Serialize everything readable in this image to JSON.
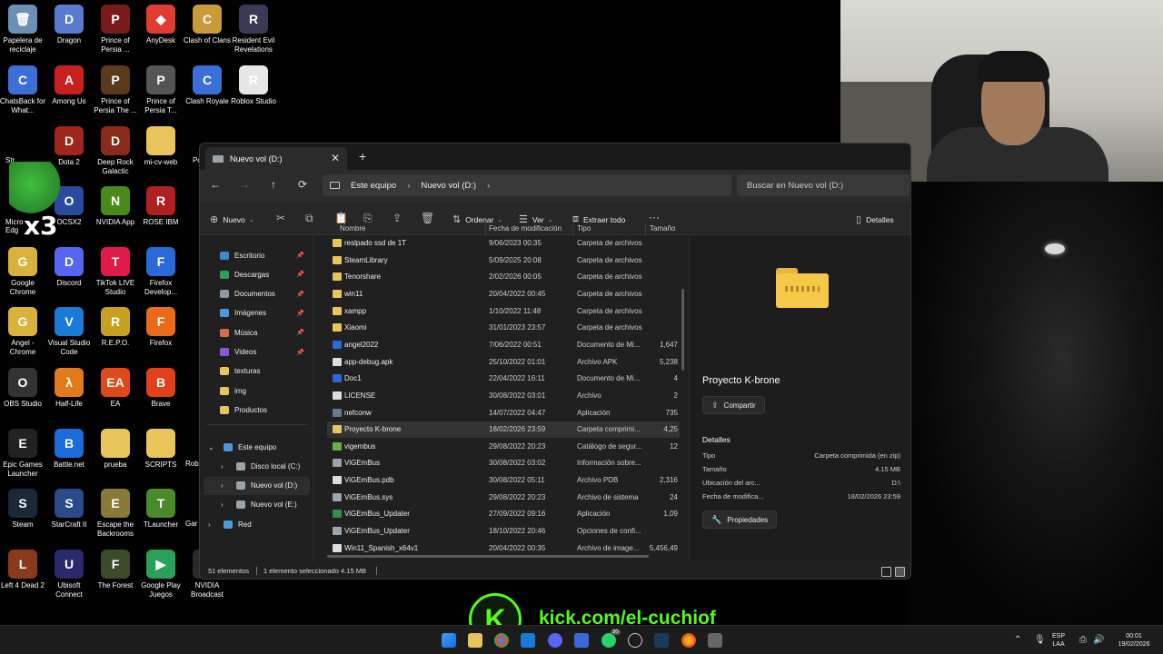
{
  "desktop": {
    "icons": [
      {
        "label": "Papelera de reciclaje",
        "color": "#6b8fb5",
        "glyph": "🗑"
      },
      {
        "label": "Dragon",
        "color": "#5a7ad0",
        "glyph": "D"
      },
      {
        "label": "Prince of Persia ...",
        "color": "#7a1b1b",
        "glyph": "P"
      },
      {
        "label": "AnyDesk",
        "color": "#e03c31",
        "glyph": "◆"
      },
      {
        "label": "Clash of Clans",
        "color": "#c89a3a",
        "glyph": "C"
      },
      {
        "label": "Resident Evil Revelations",
        "color": "#3a3a55",
        "glyph": "R"
      },
      {
        "label": "ChatsBack for What...",
        "color": "#3d6fd8",
        "glyph": "C"
      },
      {
        "label": "Among Us",
        "color": "#c82020",
        "glyph": "A"
      },
      {
        "label": "Prince of Persia The ...",
        "color": "#5a3a1a",
        "glyph": "P"
      },
      {
        "label": "Prince of Persia T...",
        "color": "#555555",
        "glyph": "P"
      },
      {
        "label": "Clash Royale",
        "color": "#3a6fd8",
        "glyph": "C"
      },
      {
        "label": "Roblox Studio",
        "color": "#e6e6e6",
        "glyph": "R"
      },
      {
        "label": "Dota 2",
        "color": "#a0251d",
        "glyph": "D"
      },
      {
        "label": "Deep Rock Galactic",
        "color": "#8a2a1a",
        "glyph": "D"
      },
      {
        "label": "mi-cv-web",
        "color": "#e8c45a",
        "glyph": ""
      },
      {
        "label": "OCSX2",
        "color": "#2a4aa0",
        "glyph": "O"
      },
      {
        "label": "NVIDIA App",
        "color": "#4a8a1a",
        "glyph": "N"
      },
      {
        "label": "ROSE IBM",
        "color": "#b02020",
        "glyph": "R"
      },
      {
        "label": "Google Chrome",
        "color": "#d8b23a",
        "glyph": "G"
      },
      {
        "label": "Discord",
        "color": "#5865f2",
        "glyph": "D"
      },
      {
        "label": "TikTok LIVE Studio",
        "color": "#e01a4a",
        "glyph": "T"
      },
      {
        "label": "Firefox Develop...",
        "color": "#2a6ad8",
        "glyph": "F"
      },
      {
        "label": "Angel - Chrome",
        "color": "#d8b23a",
        "glyph": "G"
      },
      {
        "label": "Visual Studio Code",
        "color": "#1a7ad8",
        "glyph": "V"
      },
      {
        "label": "R.E.P.O.",
        "color": "#c8a020",
        "glyph": "R"
      },
      {
        "label": "Firefox",
        "color": "#e86a1a",
        "glyph": "F"
      },
      {
        "label": "OBS Studio",
        "color": "#333333",
        "glyph": "O"
      },
      {
        "label": "Half-Life",
        "color": "#e07a1a",
        "glyph": "λ"
      },
      {
        "label": "EA",
        "color": "#e04a1a",
        "glyph": "EA"
      },
      {
        "label": "Brave",
        "color": "#e0401a",
        "glyph": "B"
      },
      {
        "label": "Epic Games Launcher",
        "color": "#222222",
        "glyph": "E"
      },
      {
        "label": "Battle.net",
        "color": "#1a6ad8",
        "glyph": "B"
      },
      {
        "label": "prueba",
        "color": "#e8c45a",
        "glyph": ""
      },
      {
        "label": "SCRIPTS",
        "color": "#e8c45a",
        "glyph": ""
      },
      {
        "label": "Steam",
        "color": "#1b2838",
        "glyph": "S"
      },
      {
        "label": "StarCraft II",
        "color": "#2a4a8a",
        "glyph": "S"
      },
      {
        "label": "Escape the Backrooms",
        "color": "#8a7a3a",
        "glyph": "E"
      },
      {
        "label": "TLauncher",
        "color": "#4a8a2a",
        "glyph": "T"
      },
      {
        "label": "Left 4 Dead 2",
        "color": "#8a3a1a",
        "glyph": "L"
      },
      {
        "label": "Ubisoft Connect",
        "color": "#2a2a6a",
        "glyph": "U"
      },
      {
        "label": "The Forest",
        "color": "#3a4a2a",
        "glyph": "F"
      },
      {
        "label": "Google Play Juegos",
        "color": "#2aa05a",
        "glyph": "▶"
      },
      {
        "label": "NVIDIA Broadcast",
        "color": "#2a2a2a",
        "glyph": "N"
      }
    ],
    "partial_labels": [
      "Po",
      "Str",
      "Micro Edg",
      "Rob",
      "Gar"
    ],
    "overlay_text": "x3"
  },
  "explorer": {
    "tab_title": "Nuevo vol (D:)",
    "tab_close": "✕",
    "new_tab": "+",
    "nav": {
      "back": "←",
      "forward": "→",
      "up": "↑",
      "refresh": "⟳"
    },
    "breadcrumb": [
      "Este equipo",
      "Nuevo vol (D:)"
    ],
    "breadcrumb_sep": "›",
    "search_placeholder": "Buscar en Nuevo vol (D:)",
    "commands": {
      "new": "Nuevo",
      "sort": "Ordenar",
      "view": "Ver",
      "extract": "Extraer todo",
      "more": "···",
      "details": "Detalles"
    },
    "sidebar": {
      "quick": [
        {
          "label": "Escritorio",
          "color": "#3a8ad8",
          "pinned": true
        },
        {
          "label": "Descargas",
          "color": "#2aa05a",
          "pinned": true
        },
        {
          "label": "Documentos",
          "color": "#8a9aaa",
          "pinned": true
        },
        {
          "label": "Imágenes",
          "color": "#4a9ae0",
          "pinned": true
        },
        {
          "label": "Música",
          "color": "#d86a4a",
          "pinned": true
        },
        {
          "label": "Videos",
          "color": "#8a5ad8",
          "pinned": true
        },
        {
          "label": "texturas",
          "color": "#e8c45a",
          "pinned": false
        },
        {
          "label": "img",
          "color": "#e8c45a",
          "pinned": false
        },
        {
          "label": "Productos",
          "color": "#e8c45a",
          "pinned": false
        }
      ],
      "tree": [
        {
          "label": "Este equipo",
          "color": "#4a9ae0",
          "expanded": true
        },
        {
          "label": "Disco local (C:)",
          "color": "#9aa4ad",
          "expanded": false
        },
        {
          "label": "Nuevo vol (D:)",
          "color": "#9aa4ad",
          "expanded": false,
          "selected": true
        },
        {
          "label": "Nuevo vol (E:)",
          "color": "#9aa4ad",
          "expanded": false
        },
        {
          "label": "Red",
          "color": "#4a9ae0",
          "expanded": false
        }
      ]
    },
    "columns": {
      "name": "Nombre",
      "date": "Fecha de modificación",
      "type": "Tipo",
      "size": "Tamaño"
    },
    "files": [
      {
        "name": "reslpado ssd de 1T",
        "date": "9/06/2023 00:35",
        "type": "Carpeta de archivos",
        "size": "",
        "color": "#e8c45a"
      },
      {
        "name": "SteamLibrary",
        "date": "5/09/2025 20:08",
        "type": "Carpeta de archivos",
        "size": "",
        "color": "#e8c45a"
      },
      {
        "name": "Tenorshare",
        "date": "2/02/2026 00:05",
        "type": "Carpeta de archivos",
        "size": "",
        "color": "#e8c45a"
      },
      {
        "name": "win11",
        "date": "20/04/2022 00:45",
        "type": "Carpeta de archivos",
        "size": "",
        "color": "#e8c45a"
      },
      {
        "name": "xampp",
        "date": "1/10/2022 11:48",
        "type": "Carpeta de archivos",
        "size": "",
        "color": "#e8c45a"
      },
      {
        "name": "Xiaomi",
        "date": "31/01/2023 23:57",
        "type": "Carpeta de archivos",
        "size": "",
        "color": "#e8c45a"
      },
      {
        "name": "angel2022",
        "date": "7/06/2022 00:51",
        "type": "Documento de Mi...",
        "size": "1,647",
        "color": "#2a6ad8"
      },
      {
        "name": "app-debug.apk",
        "date": "25/10/2022 01:01",
        "type": "Archivo APK",
        "size": "5,238",
        "color": "#dddddd"
      },
      {
        "name": "Doc1",
        "date": "22/04/2022 16:11",
        "type": "Documento de Mi...",
        "size": "4",
        "color": "#2a6ad8"
      },
      {
        "name": "LICENSE",
        "date": "30/08/2022 03:01",
        "type": "Archivo",
        "size": "2",
        "color": "#dddddd"
      },
      {
        "name": "nefconw",
        "date": "14/07/2022 04:47",
        "type": "Aplicación",
        "size": "735",
        "color": "#6a7a8a"
      },
      {
        "name": "Proyecto K-brone",
        "date": "18/02/2026 23:59",
        "type": "Carpeta comprimi...",
        "size": "4,25",
        "color": "#e8c45a",
        "selected": true
      },
      {
        "name": "vigembus",
        "date": "29/08/2022 20:23",
        "type": "Catálogo de segur...",
        "size": "12",
        "color": "#6ab04a"
      },
      {
        "name": "ViGEmBus",
        "date": "30/08/2022 03:02",
        "type": "Información sobre...",
        "size": "",
        "color": "#9aa4ad"
      },
      {
        "name": "ViGEmBus.pdb",
        "date": "30/08/2022 05:11",
        "type": "Archivo PDB",
        "size": "2,316",
        "color": "#dddddd"
      },
      {
        "name": "ViGEmBus.sys",
        "date": "29/08/2022 20:23",
        "type": "Archivo de sistema",
        "size": "24",
        "color": "#9aa4ad"
      },
      {
        "name": "ViGEmBus_Updater",
        "date": "27/09/2022 09:16",
        "type": "Aplicación",
        "size": "1,09",
        "color": "#3a8a4a"
      },
      {
        "name": "ViGEmBus_Updater",
        "date": "18/10/2022 20:46",
        "type": "Opciones de confi...",
        "size": "",
        "color": "#9aa4ad"
      },
      {
        "name": "Win11_Spanish_x64v1",
        "date": "20/04/2022 00:35",
        "type": "Archivo de image...",
        "size": "5,456,49",
        "color": "#dddddd"
      }
    ],
    "details_pane": {
      "title": "Proyecto K-brone",
      "share": "Compartir",
      "section": "Detalles",
      "props": [
        {
          "k": "Tipo",
          "v": "Carpeta comprimida (en zip)"
        },
        {
          "k": "Tamaño",
          "v": "4.15 MB"
        },
        {
          "k": "Ubicación del arc...",
          "v": "D:\\"
        },
        {
          "k": "Fecha de modifica...",
          "v": "18/02/2026 23:59"
        }
      ],
      "properties_button": "Propiedades"
    },
    "status": {
      "count": "51 elementos",
      "selection": "1 elemento seleccionado  4.15 MB"
    }
  },
  "overlay": {
    "kick_letter": "K",
    "kick_url": "kick.com/el-cuchiof"
  },
  "taskbar": {
    "badge": "30",
    "tray": {
      "lang1": "ESP",
      "lang2": "LAA",
      "time": "00:01",
      "date": "19/02/2026"
    }
  }
}
